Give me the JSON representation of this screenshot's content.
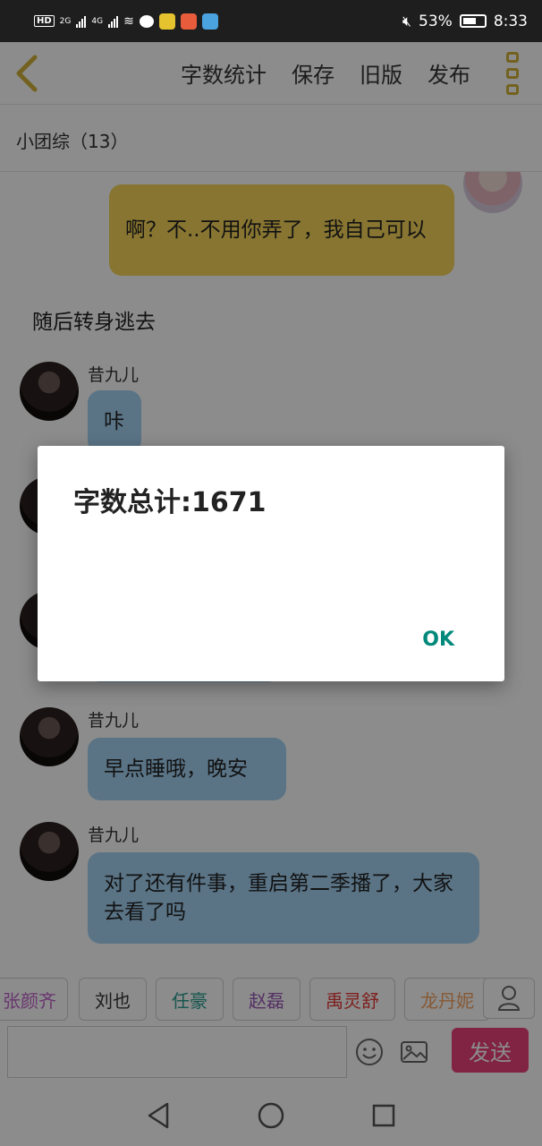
{
  "status_bar": {
    "hd": "HD",
    "net1": "2G",
    "net2": "4G",
    "battery": "53%",
    "time": "8:33"
  },
  "toolbar": {
    "back_icon": "chevron-left-icon",
    "actions": [
      "字数统计",
      "保存",
      "旧版",
      "发布"
    ],
    "more_icon": "more-vertical-icon",
    "accent": "#d2b33a"
  },
  "chat": {
    "title": "小团综（13）"
  },
  "messages": [
    {
      "type": "outgoing",
      "text": "啊？不..不用你弄了，我自己可以",
      "bubble_color": "#f6d65a"
    },
    {
      "type": "narration",
      "text": "随后转身逃去"
    },
    {
      "type": "incoming",
      "sender": "昔九儿",
      "text": "咔",
      "bubble_color": "#a4d3f4"
    },
    {
      "type": "incoming",
      "sender": "昔九儿",
      "text": "早点睡哦，晚安",
      "bubble_color": "#a4d3f4"
    },
    {
      "type": "incoming",
      "sender": "昔九儿",
      "text": "对了还有件事，重启第二季播了，大家去看了吗",
      "bubble_color": "#a4d3f4"
    }
  ],
  "characters": [
    {
      "name": "张颜齐",
      "color": "#c061cb"
    },
    {
      "name": "刘也",
      "color": "#333333"
    },
    {
      "name": "任豪",
      "color": "#2a9d8f"
    },
    {
      "name": "赵磊",
      "color": "#9b59b6"
    },
    {
      "name": "禹灵舒",
      "color": "#e53935"
    },
    {
      "name": "龙丹妮",
      "color": "#f4a261"
    }
  ],
  "input": {
    "placeholder": "",
    "send_label": "发送",
    "send_color": "#ec407a"
  },
  "dialog": {
    "message": "字数总计:1671",
    "ok_label": "OK",
    "ok_color": "#00897b"
  }
}
